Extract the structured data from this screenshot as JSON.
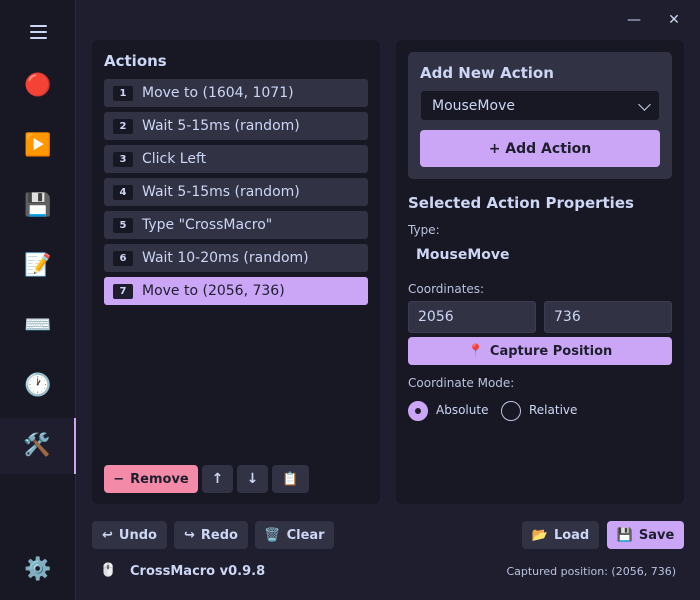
{
  "window": {
    "minimize_glyph": "—",
    "close_glyph": "✕"
  },
  "sidebar": {
    "items": [
      {
        "name": "menu-icon",
        "glyph": ""
      },
      {
        "name": "record-icon",
        "glyph": "🔴"
      },
      {
        "name": "play-icon",
        "glyph": "▶️"
      },
      {
        "name": "save-icon",
        "glyph": "💾"
      },
      {
        "name": "editor-icon",
        "glyph": "📝"
      },
      {
        "name": "keyboard-icon",
        "glyph": "⌨️"
      },
      {
        "name": "clock-icon",
        "glyph": "🕐"
      },
      {
        "name": "tools-icon",
        "glyph": "🛠️"
      },
      {
        "name": "settings-icon",
        "glyph": "⚙️"
      }
    ],
    "active": "tools-icon"
  },
  "actions_panel": {
    "title": "Actions",
    "items": [
      {
        "num": "1",
        "label": "Move to (1604, 1071)"
      },
      {
        "num": "2",
        "label": "Wait 5-15ms (random)"
      },
      {
        "num": "3",
        "label": "Click Left"
      },
      {
        "num": "4",
        "label": "Wait 5-15ms (random)"
      },
      {
        "num": "5",
        "label": "Type \"CrossMacro\""
      },
      {
        "num": "6",
        "label": "Wait 10-20ms (random)"
      },
      {
        "num": "7",
        "label": "Move to (2056, 736)"
      }
    ],
    "selected_index": 6,
    "remove_label": "Remove",
    "remove_glyph": "−",
    "move_up_glyph": "↑",
    "move_down_glyph": "↓",
    "duplicate_glyph": "📋"
  },
  "add_action": {
    "title": "Add New Action",
    "selected_type": "MouseMove",
    "add_label": "+ Add Action"
  },
  "properties": {
    "title": "Selected Action Properties",
    "type_label": "Type:",
    "type_value": "MouseMove",
    "coords_label": "Coordinates:",
    "x_value": "2056",
    "y_value": "736",
    "capture_glyph": "📍",
    "capture_label": "Capture Position",
    "mode_label": "Coordinate Mode:",
    "mode_absolute": "Absolute",
    "mode_relative": "Relative",
    "mode_selected": "Absolute"
  },
  "toolbar": {
    "undo_glyph": "↩",
    "undo_label": "Undo",
    "redo_glyph": "↪",
    "redo_label": "Redo",
    "clear_glyph": "🗑️",
    "clear_label": "Clear",
    "load_glyph": "📂",
    "load_label": "Load",
    "save_glyph": "💾",
    "save_label": "Save"
  },
  "status": {
    "mouse_glyph": "🖱️",
    "app_name": "CrossMacro v0.9.8",
    "captured": "Captured position: (2056, 736)"
  },
  "colors": {
    "bg": "#1e1e2e",
    "panel": "#181825",
    "surface": "#313244",
    "accent": "#cba6f7",
    "danger": "#f38ba8",
    "text": "#cdd6f4"
  }
}
